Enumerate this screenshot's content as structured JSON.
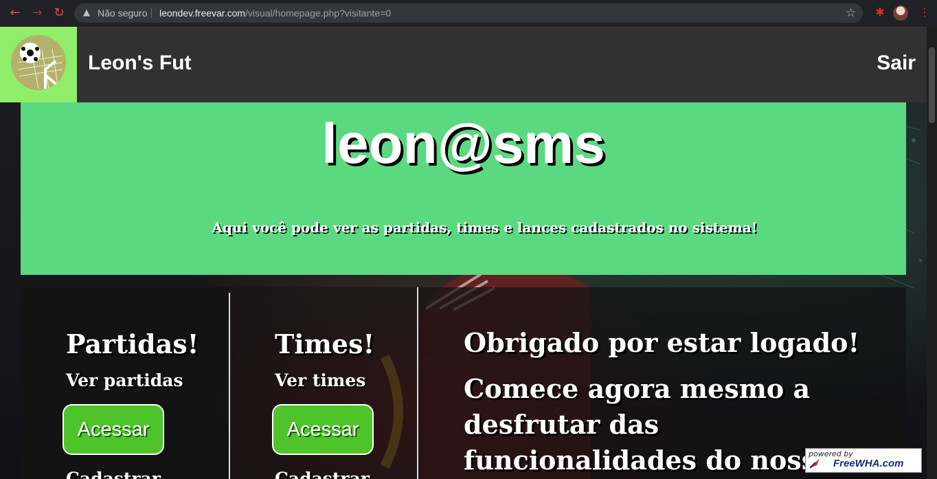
{
  "browser": {
    "security_label": "Não seguro",
    "url_host": "leondev.freevar.com",
    "url_path": "/visual/homepage.php?visitante=0",
    "icons": {
      "back": "back-arrow-icon",
      "forward": "forward-arrow-icon",
      "reload": "reload-icon",
      "warning": "warning-icon",
      "star": "star-icon",
      "extension": "puzzle-icon",
      "menu": "kebab-menu-icon"
    }
  },
  "header": {
    "brand": "Leon's Fut",
    "logout_label": "Sair",
    "logo_icon": "soccer-ball-goal-icon",
    "colors": {
      "bar": "#313131",
      "logo_bg": "#90ee6a"
    }
  },
  "hero": {
    "title": "leon@sms",
    "subtitle": "Aqui você pode ver as partidas, times e lances cadastrados no sistema!",
    "color": "#5ad981"
  },
  "cards": [
    {
      "title": "Partidas!",
      "subtitle": "Ver partidas",
      "button_label": "Acessar",
      "next_label": "Cadastrar"
    },
    {
      "title": "Times!",
      "subtitle": "Ver times",
      "button_label": "Acessar",
      "next_label": "Cadastrar"
    }
  ],
  "welcome": {
    "heading": "Obrigado por estar logado!",
    "body": "Comece agora mesmo a desfrutar das funcionalidades do nosso"
  },
  "badge": {
    "powered_by": "powered by",
    "brand": "FreeWHA.com"
  },
  "colors": {
    "button": "#4ec42a"
  }
}
